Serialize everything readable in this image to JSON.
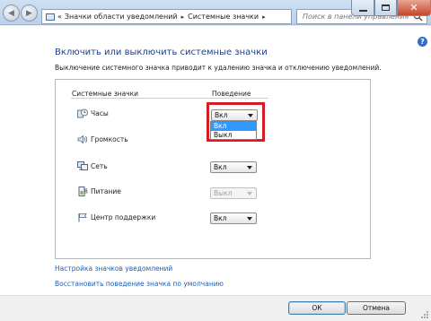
{
  "window": {
    "back_icon": "back-arrow-icon",
    "forward_icon": "forward-arrow-icon",
    "minimize_icon": "minimize-icon",
    "maximize_icon": "maximize-icon",
    "close_icon": "close-icon",
    "close_color": "#c7462a"
  },
  "address": {
    "icon": "control-panel-icon",
    "breadcrumb": [
      "Значки области уведомлений",
      "Системные значки"
    ],
    "separator": "▸",
    "prefix": "«"
  },
  "search": {
    "placeholder": "Поиск в панели управления",
    "icon": "search-icon"
  },
  "help": {
    "label": "?"
  },
  "page": {
    "title": "Включить или выключить системные значки",
    "description": "Выключение системного значка приводит к удалению значка и отключению уведомлений."
  },
  "table": {
    "col_icons": "Системные значки",
    "col_behavior": "Поведение",
    "rows": [
      {
        "icon": "clock-icon",
        "label": "Часы",
        "value": "Вкл",
        "enabled": true
      },
      {
        "icon": "volume-icon",
        "label": "Громкость",
        "value": "",
        "enabled": true
      },
      {
        "icon": "network-icon",
        "label": "Сеть",
        "value": "Вкл",
        "enabled": true
      },
      {
        "icon": "power-icon",
        "label": "Питание",
        "value": "Выкл",
        "enabled": false
      },
      {
        "icon": "action-center-flag-icon",
        "label": "Центр поддержки",
        "value": "Вкл",
        "enabled": true
      }
    ],
    "dropdown_options": [
      "Вкл",
      "Выкл"
    ],
    "dropdown_selected": "Вкл",
    "highlight_color": "#d31e26"
  },
  "links": {
    "customize": "Настройка значков уведомлений",
    "restore": "Восстановить поведение значка по умолчанию"
  },
  "footer": {
    "ok": "ОК",
    "cancel": "Отмена"
  }
}
